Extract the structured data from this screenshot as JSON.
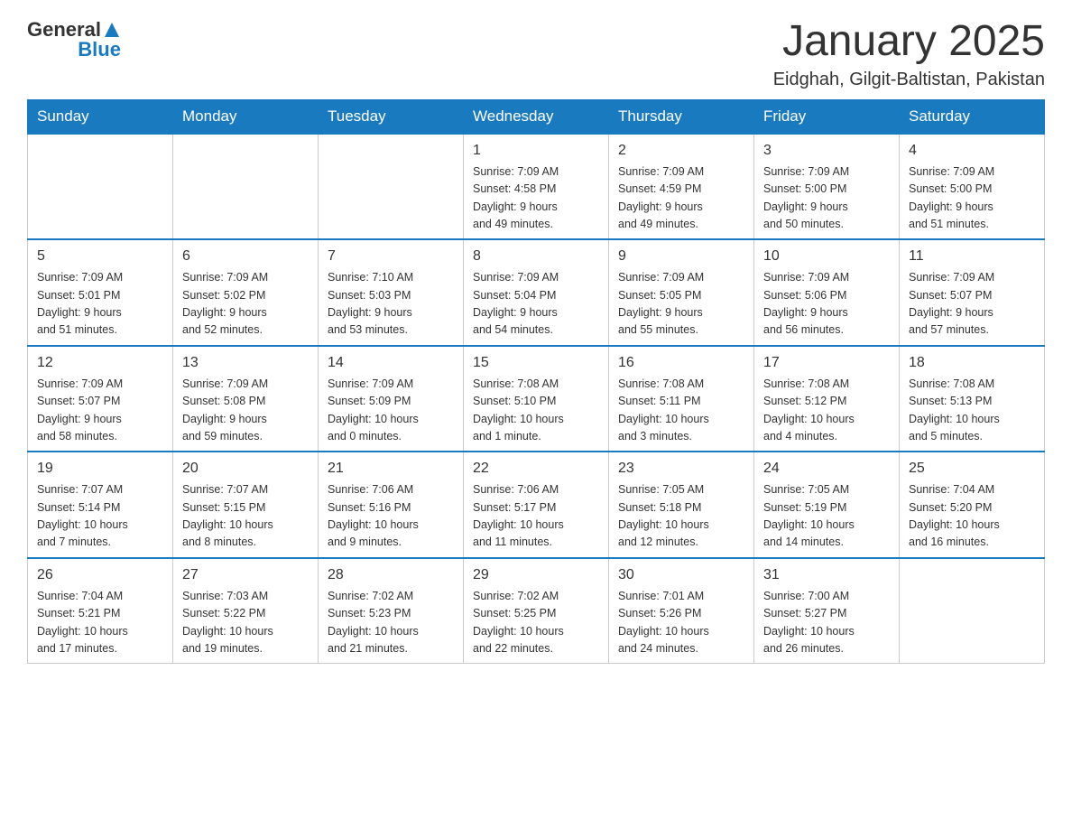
{
  "header": {
    "logo": {
      "general": "General",
      "blue": "Blue"
    },
    "title": "January 2025",
    "location": "Eidghah, Gilgit-Baltistan, Pakistan"
  },
  "days_of_week": [
    "Sunday",
    "Monday",
    "Tuesday",
    "Wednesday",
    "Thursday",
    "Friday",
    "Saturday"
  ],
  "weeks": [
    {
      "days": [
        {
          "number": "",
          "info": ""
        },
        {
          "number": "",
          "info": ""
        },
        {
          "number": "",
          "info": ""
        },
        {
          "number": "1",
          "info": "Sunrise: 7:09 AM\nSunset: 4:58 PM\nDaylight: 9 hours\nand 49 minutes."
        },
        {
          "number": "2",
          "info": "Sunrise: 7:09 AM\nSunset: 4:59 PM\nDaylight: 9 hours\nand 49 minutes."
        },
        {
          "number": "3",
          "info": "Sunrise: 7:09 AM\nSunset: 5:00 PM\nDaylight: 9 hours\nand 50 minutes."
        },
        {
          "number": "4",
          "info": "Sunrise: 7:09 AM\nSunset: 5:00 PM\nDaylight: 9 hours\nand 51 minutes."
        }
      ]
    },
    {
      "days": [
        {
          "number": "5",
          "info": "Sunrise: 7:09 AM\nSunset: 5:01 PM\nDaylight: 9 hours\nand 51 minutes."
        },
        {
          "number": "6",
          "info": "Sunrise: 7:09 AM\nSunset: 5:02 PM\nDaylight: 9 hours\nand 52 minutes."
        },
        {
          "number": "7",
          "info": "Sunrise: 7:10 AM\nSunset: 5:03 PM\nDaylight: 9 hours\nand 53 minutes."
        },
        {
          "number": "8",
          "info": "Sunrise: 7:09 AM\nSunset: 5:04 PM\nDaylight: 9 hours\nand 54 minutes."
        },
        {
          "number": "9",
          "info": "Sunrise: 7:09 AM\nSunset: 5:05 PM\nDaylight: 9 hours\nand 55 minutes."
        },
        {
          "number": "10",
          "info": "Sunrise: 7:09 AM\nSunset: 5:06 PM\nDaylight: 9 hours\nand 56 minutes."
        },
        {
          "number": "11",
          "info": "Sunrise: 7:09 AM\nSunset: 5:07 PM\nDaylight: 9 hours\nand 57 minutes."
        }
      ]
    },
    {
      "days": [
        {
          "number": "12",
          "info": "Sunrise: 7:09 AM\nSunset: 5:07 PM\nDaylight: 9 hours\nand 58 minutes."
        },
        {
          "number": "13",
          "info": "Sunrise: 7:09 AM\nSunset: 5:08 PM\nDaylight: 9 hours\nand 59 minutes."
        },
        {
          "number": "14",
          "info": "Sunrise: 7:09 AM\nSunset: 5:09 PM\nDaylight: 10 hours\nand 0 minutes."
        },
        {
          "number": "15",
          "info": "Sunrise: 7:08 AM\nSunset: 5:10 PM\nDaylight: 10 hours\nand 1 minute."
        },
        {
          "number": "16",
          "info": "Sunrise: 7:08 AM\nSunset: 5:11 PM\nDaylight: 10 hours\nand 3 minutes."
        },
        {
          "number": "17",
          "info": "Sunrise: 7:08 AM\nSunset: 5:12 PM\nDaylight: 10 hours\nand 4 minutes."
        },
        {
          "number": "18",
          "info": "Sunrise: 7:08 AM\nSunset: 5:13 PM\nDaylight: 10 hours\nand 5 minutes."
        }
      ]
    },
    {
      "days": [
        {
          "number": "19",
          "info": "Sunrise: 7:07 AM\nSunset: 5:14 PM\nDaylight: 10 hours\nand 7 minutes."
        },
        {
          "number": "20",
          "info": "Sunrise: 7:07 AM\nSunset: 5:15 PM\nDaylight: 10 hours\nand 8 minutes."
        },
        {
          "number": "21",
          "info": "Sunrise: 7:06 AM\nSunset: 5:16 PM\nDaylight: 10 hours\nand 9 minutes."
        },
        {
          "number": "22",
          "info": "Sunrise: 7:06 AM\nSunset: 5:17 PM\nDaylight: 10 hours\nand 11 minutes."
        },
        {
          "number": "23",
          "info": "Sunrise: 7:05 AM\nSunset: 5:18 PM\nDaylight: 10 hours\nand 12 minutes."
        },
        {
          "number": "24",
          "info": "Sunrise: 7:05 AM\nSunset: 5:19 PM\nDaylight: 10 hours\nand 14 minutes."
        },
        {
          "number": "25",
          "info": "Sunrise: 7:04 AM\nSunset: 5:20 PM\nDaylight: 10 hours\nand 16 minutes."
        }
      ]
    },
    {
      "days": [
        {
          "number": "26",
          "info": "Sunrise: 7:04 AM\nSunset: 5:21 PM\nDaylight: 10 hours\nand 17 minutes."
        },
        {
          "number": "27",
          "info": "Sunrise: 7:03 AM\nSunset: 5:22 PM\nDaylight: 10 hours\nand 19 minutes."
        },
        {
          "number": "28",
          "info": "Sunrise: 7:02 AM\nSunset: 5:23 PM\nDaylight: 10 hours\nand 21 minutes."
        },
        {
          "number": "29",
          "info": "Sunrise: 7:02 AM\nSunset: 5:25 PM\nDaylight: 10 hours\nand 22 minutes."
        },
        {
          "number": "30",
          "info": "Sunrise: 7:01 AM\nSunset: 5:26 PM\nDaylight: 10 hours\nand 24 minutes."
        },
        {
          "number": "31",
          "info": "Sunrise: 7:00 AM\nSunset: 5:27 PM\nDaylight: 10 hours\nand 26 minutes."
        },
        {
          "number": "",
          "info": ""
        }
      ]
    }
  ]
}
